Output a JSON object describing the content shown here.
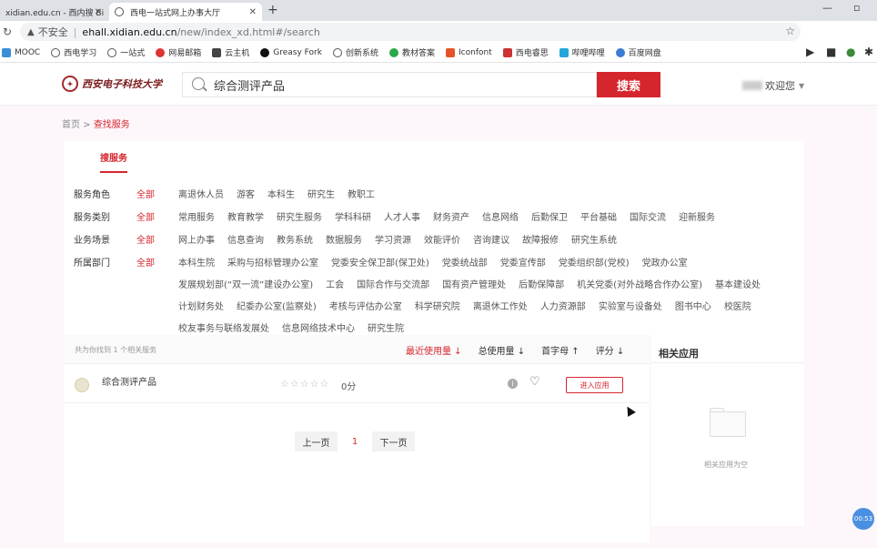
{
  "browser": {
    "tabs": [
      {
        "title": "xidian.edu.cn - 西内搜 Bi"
      },
      {
        "title": "西电一站式网上办事大厅"
      }
    ],
    "address": {
      "security": "不安全",
      "host": "ehall.xidian.edu.cn",
      "path": "/new/index_xd.html#/search"
    },
    "bookmarks": [
      "MOOC",
      "西电学习",
      "一站式",
      "网易邮箱",
      "云主机",
      "Greasy Fork",
      "创新系统",
      "教材答案",
      "Iconfont",
      "西电睿思",
      "哔哩哔哩",
      "百度网盘"
    ]
  },
  "site": {
    "logo_text": "西安电子科技大学",
    "search_value": "综合测评产品",
    "search_button": "搜索",
    "welcome": "欢迎您"
  },
  "breadcrumb": {
    "home": "首页",
    "sep": " > ",
    "current": "查找服务"
  },
  "panel": {
    "tab": "搜服务",
    "filters": [
      {
        "label": "服务角色",
        "all": "全部",
        "options": [
          "离退休人员",
          "游客",
          "本科生",
          "研究生",
          "教职工"
        ]
      },
      {
        "label": "服务类别",
        "all": "全部",
        "options": [
          "常用服务",
          "教育教学",
          "研究生服务",
          "学科科研",
          "人才人事",
          "财务资产",
          "信息网络",
          "后勤保卫",
          "平台基础",
          "国际交流",
          "迎新服务"
        ]
      },
      {
        "label": "业务场景",
        "all": "全部",
        "options": [
          "网上办事",
          "信息查询",
          "教务系统",
          "数据服务",
          "学习资源",
          "效能评价",
          "咨询建议",
          "故障报修",
          "研究生系统"
        ]
      },
      {
        "label": "所属部门",
        "all": "全部",
        "options": [
          "本科生院",
          "采购与招标管理办公室",
          "党委安全保卫部(保卫处)",
          "党委统战部",
          "党委宣传部",
          "党委组织部(党校)",
          "党政办公室",
          "发展规划部(“双一流”建设办公室)",
          "工会",
          "国际合作与交流部",
          "国有资产管理处",
          "后勤保障部",
          "机关党委(对外战略合作办公室)",
          "基本建设处",
          "计划财务处",
          "纪委办公室(监察处)",
          "考核与评估办公室",
          "科学研究院",
          "离退休工作处",
          "人力资源部",
          "实验室与设备处",
          "图书中心",
          "校医院",
          "校友事务与联络发展处",
          "信息网络技术中心",
          "研究生院"
        ]
      }
    ]
  },
  "results": {
    "count_text": "共为你找到 1 个相关服务",
    "sorts": [
      {
        "label": "最近使用量 ↓"
      },
      {
        "label": "总使用量 ↓"
      },
      {
        "label": "首字母 ↑"
      },
      {
        "label": "评分 ↓"
      }
    ],
    "items": [
      {
        "name": "综合测评产品",
        "stars": "☆☆☆☆☆",
        "score": "0分",
        "enter": "进入应用"
      }
    ],
    "pager": {
      "prev": "上一页",
      "current": "1",
      "next": "下一页"
    }
  },
  "related": {
    "title": "相关应用",
    "empty": "相关应用为空"
  },
  "overlay": {
    "timer": "00:53"
  },
  "colors": {
    "accent": "#d6262d",
    "background": "#fdf6fb"
  }
}
